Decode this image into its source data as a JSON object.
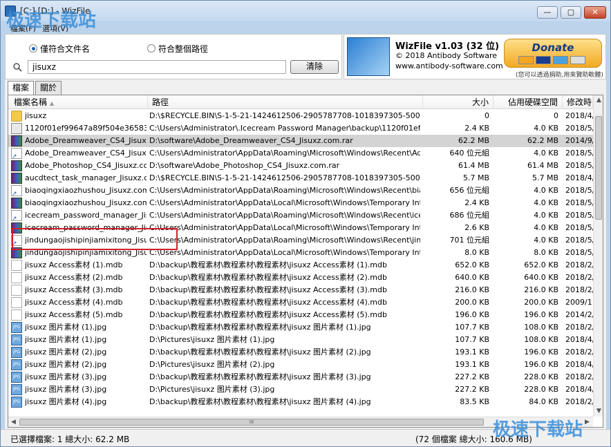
{
  "window": {
    "title": "[C:] [D:] - WizFile",
    "controls": {
      "minimize": "—",
      "maximize": "▢",
      "close": "✕"
    }
  },
  "menu": [
    "檔案(F)",
    "選項(V)"
  ],
  "search": {
    "radio_filename": "僅符合文件名",
    "radio_fullpath": "符合整個路徑",
    "selected_mode": "filename",
    "query": "jisuxz",
    "clear_label": "清除"
  },
  "brand": {
    "name": "WizFile v1.03 (32 位)",
    "copyright": "© 2018 Antibody Software",
    "url": "www.antibody-software.com",
    "donate_label": "Donate",
    "cards": [
      "VISA",
      "MC",
      "AMEX",
      "BANK"
    ],
    "note": "(您可以透過捐助,用來贊助軟體)"
  },
  "tabs": [
    {
      "label": "檔案",
      "active": true
    },
    {
      "label": "關於",
      "active": false
    }
  ],
  "columns": {
    "name": "檔案名稱",
    "path": "路徑",
    "size": "大小",
    "disk": "佔用硬碟空間",
    "modified": "修改時"
  },
  "rows": [
    {
      "icon": "folder",
      "name": "jisuxz",
      "path": "D:\\$RECYCLE.BIN\\S-1-5-21-1424612506-2905787708-1018397305-500\\$RYAGO",
      "size": "0",
      "disk": "0",
      "modified": "2018/4/"
    },
    {
      "icon": "generic",
      "name": "1120f01ef99647a89f504e36583ca",
      "path": "C:\\Users\\Administrator\\.Icecream Password Manager\\backup\\1120f01ef99647a8",
      "size": "2.4 KB",
      "disk": "4.0 KB",
      "modified": "2018/5/"
    },
    {
      "icon": "rar",
      "name": "Adobe_Dreamweaver_CS4_Jisuxz",
      "path": "D:\\software\\Adobe_Dreamweaver_CS4_Jisuxz.com.rar",
      "size": "62.2 MB",
      "disk": "62.2 MB",
      "modified": "2014/9/",
      "selected": true
    },
    {
      "icon": "lnk",
      "name": "Adobe_Dreamweaver_CS4_Jisuxz",
      "path": "C:\\Users\\Administrator\\AppData\\Roaming\\Microsoft\\Windows\\Recent\\Adobe_Dre",
      "size": "640 位元組",
      "disk": "4.0 KB",
      "modified": "2018/5/"
    },
    {
      "icon": "rar",
      "name": "Adobe_Photoshop_CS4_Jisuxz.com",
      "path": "D:\\software\\Adobe_Photoshop_CS4_Jisuxz.com.rar",
      "size": "61.4 MB",
      "disk": "61.4 MB",
      "modified": "2018/5/"
    },
    {
      "icon": "rar",
      "name": "aucdtect_task_manager_Jisuxz.co",
      "path": "D:\\$RECYCLE.BIN\\S-1-5-21-1424612506-2905787708-1018397305-500\\$RS90UC",
      "size": "5.7 MB",
      "disk": "5.7 MB",
      "modified": "2018/4/"
    },
    {
      "icon": "lnk",
      "name": "biaoqingxiaozhushou_Jisuxz.com.r",
      "path": "C:\\Users\\Administrator\\AppData\\Roaming\\Microsoft\\Windows\\Recent\\biaoqingxia",
      "size": "656 位元組",
      "disk": "4.0 KB",
      "modified": "2018/5/"
    },
    {
      "icon": "rar",
      "name": "biaoqingxiaozhushou_Jisuxz.com[1",
      "path": "C:\\Users\\Administrator\\AppData\\Local\\Microsoft\\Windows\\Temporary Internet Fil",
      "size": "2.4 KB",
      "disk": "4.0 KB",
      "modified": "2018/5/"
    },
    {
      "icon": "lnk",
      "name": "icecream_password_manager_Jisu",
      "path": "C:\\Users\\Administrator\\AppData\\Roaming\\Microsoft\\Windows\\Recent\\icecream_p",
      "size": "686 位元組",
      "disk": "4.0 KB",
      "modified": "2018/5/"
    },
    {
      "icon": "rar",
      "name": "icecream_password_manager_Jisu",
      "path": "C:\\Users\\Administrator\\AppData\\Local\\Microsoft\\Windows\\Temporary Internet Fil",
      "size": "2.6 KB",
      "disk": "4.0 KB",
      "modified": "2018/5/"
    },
    {
      "icon": "lnk",
      "name": "jindungaojishipinjiamixitong_Jisuxz",
      "path": "C:\\Users\\Administrator\\AppData\\Roaming\\Microsoft\\Windows\\Recent\\jindungaoji",
      "size": "701 位元組",
      "disk": "4.0 KB",
      "modified": "2018/5/"
    },
    {
      "icon": "rar",
      "name": "jindungaojishipinjiamixitong_Jisuxz",
      "path": "C:\\Users\\Administrator\\AppData\\Local\\Microsoft\\Windows\\Temporary Internet Fil",
      "size": "8.0 KB",
      "disk": "8.0 KB",
      "modified": "2018/5/"
    },
    {
      "icon": "doc",
      "name": "jisuxz Access素材 (1).mdb",
      "path": "D:\\backup\\教程素材\\教程素材\\教程素材\\jisuxz Access素材 (1).mdb",
      "size": "652.0 KB",
      "disk": "652.0 KB",
      "modified": "2018/2/"
    },
    {
      "icon": "doc",
      "name": "jisuxz Access素材 (2).mdb",
      "path": "D:\\backup\\教程素材\\教程素材\\教程素材\\jisuxz Access素材 (2).mdb",
      "size": "640.0 KB",
      "disk": "640.0 KB",
      "modified": "2018/2/"
    },
    {
      "icon": "doc",
      "name": "jisuxz Access素材 (3).mdb",
      "path": "D:\\backup\\教程素材\\教程素材\\教程素材\\jisuxz Access素材 (3).mdb",
      "size": "216.0 KB",
      "disk": "216.0 KB",
      "modified": "2018/2/"
    },
    {
      "icon": "doc",
      "name": "jisuxz Access素材 (4).mdb",
      "path": "D:\\backup\\教程素材\\教程素材\\教程素材\\jisuxz Access素材 (4).mdb",
      "size": "200.0 KB",
      "disk": "200.0 KB",
      "modified": "2009/1:"
    },
    {
      "icon": "doc",
      "name": "jisuxz Access素材 (5).mdb",
      "path": "D:\\backup\\教程素材\\教程素材\\教程素材\\jisuxz Access素材 (5).mdb",
      "size": "196.0 KB",
      "disk": "196.0 KB",
      "modified": "2014/2/"
    },
    {
      "icon": "jpg",
      "name": "jisuxz 图片素材 (1).jpg",
      "path": "D:\\backup\\教程素材\\教程素材\\教程素材\\jisuxz 图片素材 (1).jpg",
      "size": "107.7 KB",
      "disk": "108.0 KB",
      "modified": "2018/2/"
    },
    {
      "icon": "jpg",
      "name": "jisuxz 图片素材 (1).jpg",
      "path": "D:\\Pictures\\jisuxz 图片素材 (1).jpg",
      "size": "107.7 KB",
      "disk": "108.0 KB",
      "modified": "2018/4/"
    },
    {
      "icon": "jpg",
      "name": "jisuxz 图片素材 (2).jpg",
      "path": "D:\\backup\\教程素材\\教程素材\\教程素材\\jisuxz 图片素材 (2).jpg",
      "size": "193.1 KB",
      "disk": "196.0 KB",
      "modified": "2018/2/"
    },
    {
      "icon": "jpg",
      "name": "jisuxz 图片素材 (2).jpg",
      "path": "D:\\Pictures\\jisuxz 图片素材 (2).jpg",
      "size": "193.1 KB",
      "disk": "196.0 KB",
      "modified": "2018/4/"
    },
    {
      "icon": "jpg",
      "name": "jisuxz 图片素材 (3).jpg",
      "path": "D:\\backup\\教程素材\\教程素材\\教程素材\\jisuxz 图片素材 (3).jpg",
      "size": "227.2 KB",
      "disk": "228.0 KB",
      "modified": "2018/2/"
    },
    {
      "icon": "jpg",
      "name": "jisuxz 图片素材 (3).jpg",
      "path": "D:\\Pictures\\jisuxz 图片素材 (3).jpg",
      "size": "227.2 KB",
      "disk": "228.0 KB",
      "modified": "2018/4/"
    },
    {
      "icon": "jpg",
      "name": "jisuxz 图片素材 (4).jpg",
      "path": "D:\\backup\\教程素材\\教程素材\\教程素材\\jisuxz 图片素材 (4).jpg",
      "size": "83.5 KB",
      "disk": "84.0 KB",
      "modified": "2018/2/"
    }
  ],
  "scrollbar": {
    "grip": "III",
    "up": "▲",
    "down": "▼",
    "left": "◀",
    "right": "▶"
  },
  "status": {
    "left": "已選擇檔案: 1   總大小: 62.2 MB",
    "right": "(72 個檔案   總大小: 160.6 MB)"
  },
  "watermark": "极速下载站",
  "colors": {
    "selection_highlight": "#d0202a",
    "selected_row": "#d4d4d4"
  }
}
